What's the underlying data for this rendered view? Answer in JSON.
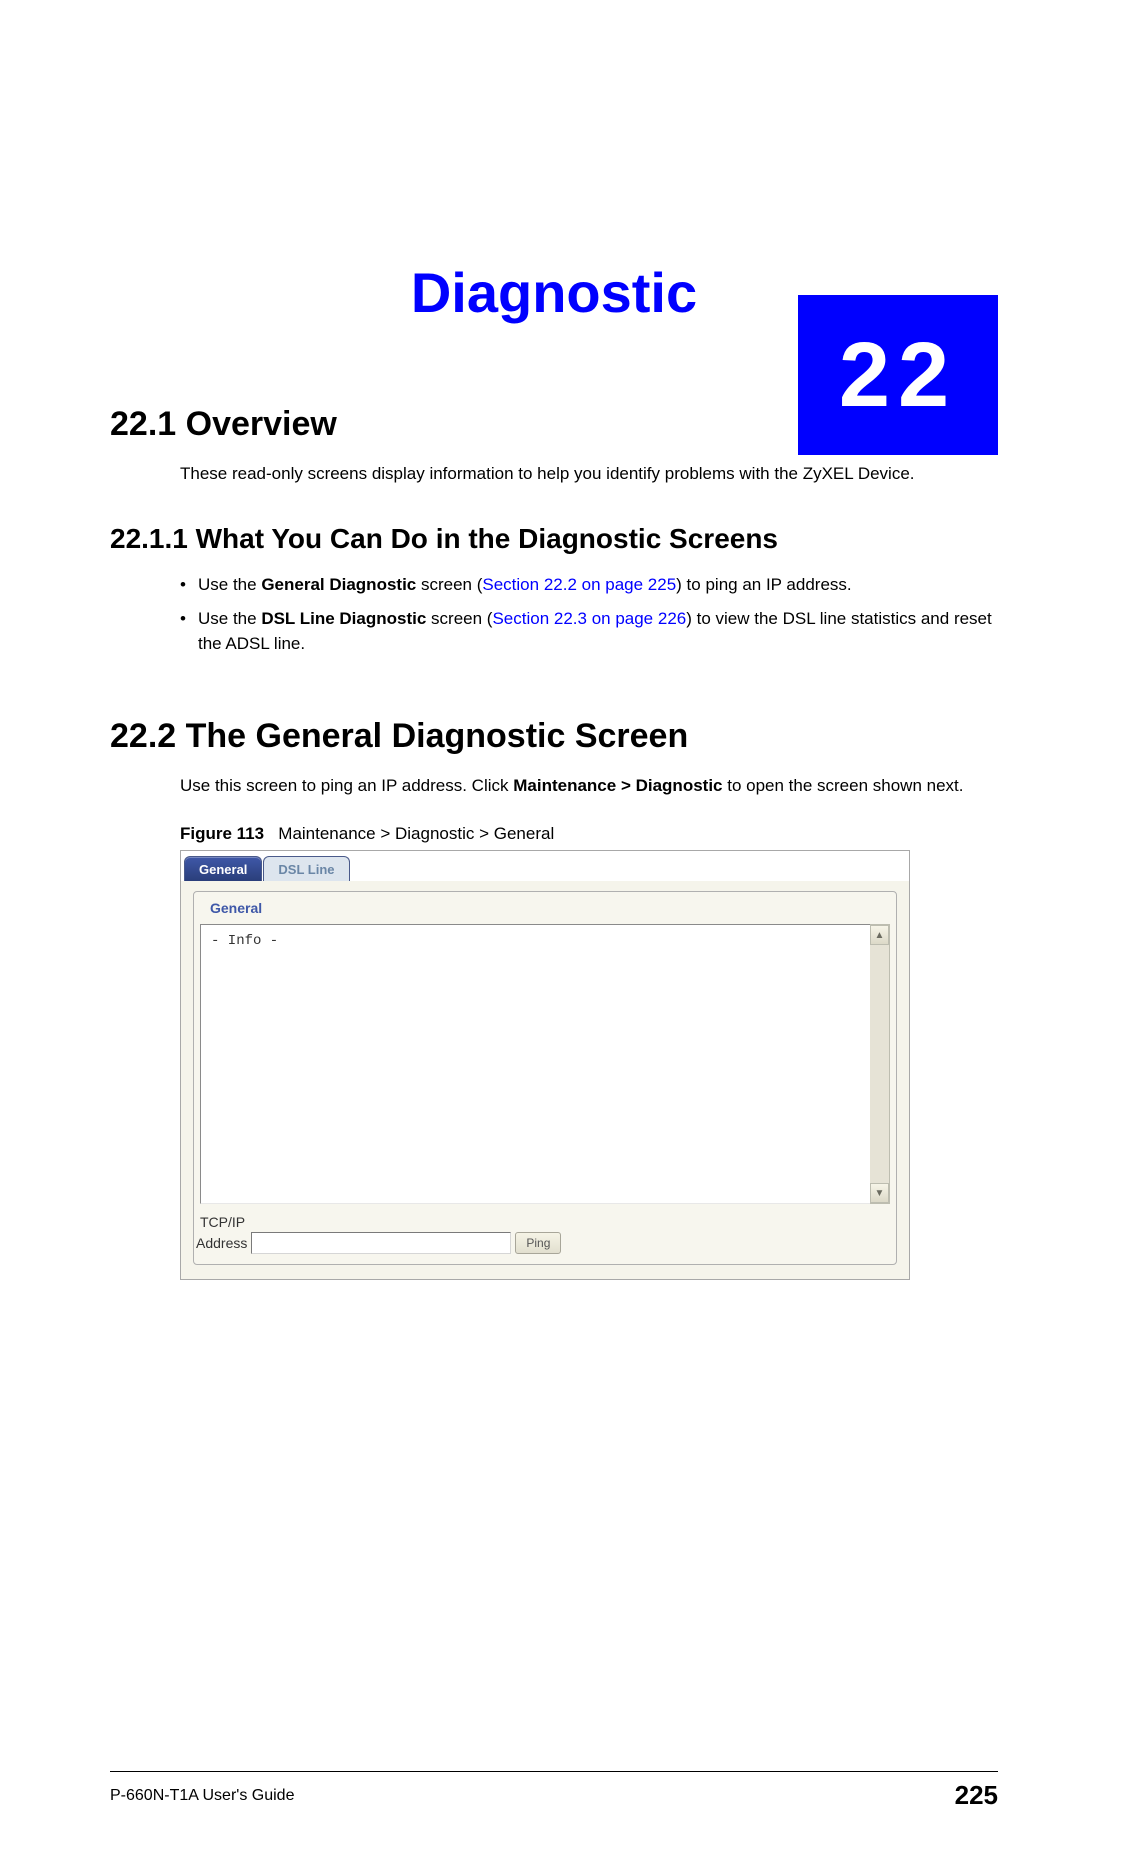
{
  "chapter": {
    "number": "22",
    "title": "Diagnostic"
  },
  "sections": {
    "s1": {
      "heading": "22.1  Overview",
      "body": "These read-only screens display information to help you identify problems with the ZyXEL Device."
    },
    "s1_1": {
      "heading": "22.1.1  What You Can Do in the Diagnostic Screens",
      "bullets": [
        {
          "pre": "Use the ",
          "bold": "General Diagnostic",
          "mid": " screen (",
          "link": "Section 22.2 on page 225",
          "post": ") to ping an IP address."
        },
        {
          "pre": "Use the ",
          "bold": "DSL Line Diagnostic",
          "mid": " screen (",
          "link": "Section 22.3 on page 226",
          "post": ") to view the DSL line statistics and reset the ADSL line."
        }
      ]
    },
    "s2": {
      "heading": "22.2  The General Diagnostic Screen",
      "body_pre": "Use this screen to ping an IP address. Click ",
      "body_bold": "Maintenance > Diagnostic",
      "body_post": " to open the screen shown next."
    }
  },
  "figure": {
    "label": "Figure 113",
    "caption": "Maintenance > Diagnostic > General",
    "tabs": {
      "active": "General",
      "inactive": "DSL Line"
    },
    "fieldset_title": "General",
    "info_text": "- Info -",
    "tcpip_label": "TCP/IP",
    "address_label": "Address",
    "address_value": "",
    "ping_label": "Ping"
  },
  "footer": {
    "guide": "P-660N-T1A User's Guide",
    "page": "225"
  }
}
